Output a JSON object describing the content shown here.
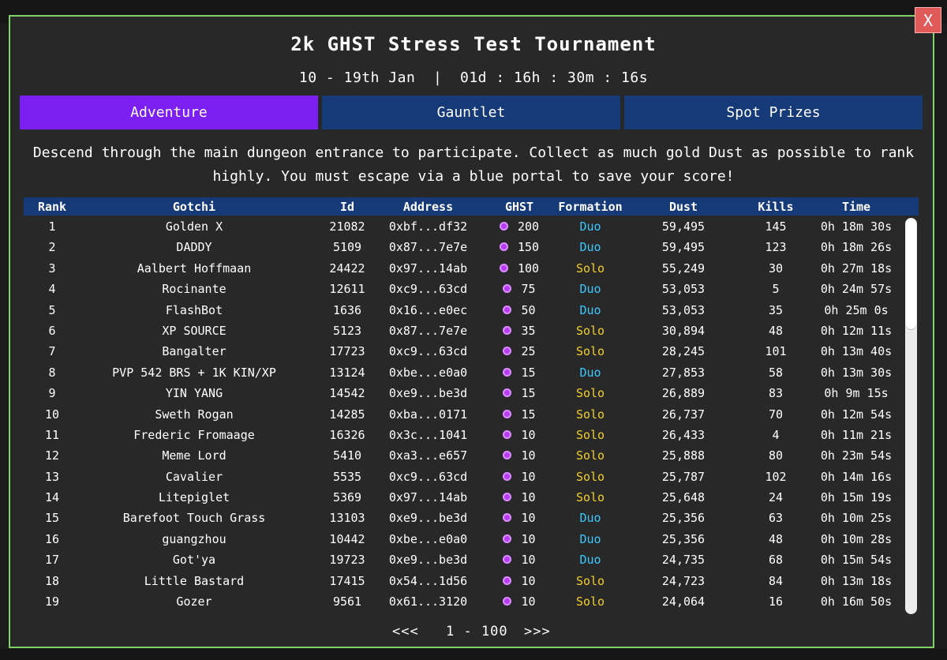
{
  "window": {
    "close_label": "X"
  },
  "header": {
    "title": "2k GHST Stress Test Tournament",
    "subtitle": "10 - 19th Jan  |  01d : 16h : 30m : 16s"
  },
  "tabs": [
    {
      "label": "Adventure",
      "active": true
    },
    {
      "label": "Gauntlet",
      "active": false
    },
    {
      "label": "Spot Prizes",
      "active": false
    }
  ],
  "description": "Descend through the main dungeon entrance to participate. Collect as much gold Dust as possible to rank highly. You must escape via a blue portal to save your score!",
  "columns": {
    "rank": "Rank",
    "gotchi": "Gotchi",
    "id": "Id",
    "address": "Address",
    "ghst": "GHST",
    "formation": "Formation",
    "dust": "Dust",
    "kills": "Kills",
    "time": "Time"
  },
  "colors": {
    "accent": "#7b1ff2",
    "tab": "#163a78",
    "duo": "#3cc8ff",
    "solo": "#f2cf2d",
    "border": "#7fd16a"
  },
  "rows": [
    {
      "rank": "1",
      "gotchi": "Golden X",
      "id": "21082",
      "address": "0xbf...df32",
      "ghst": "200",
      "formation": "Duo",
      "dust": "59,495",
      "kills": "145",
      "time": "0h 18m 30s"
    },
    {
      "rank": "2",
      "gotchi": "DADDY",
      "id": "5109",
      "address": "0x87...7e7e",
      "ghst": "150",
      "formation": "Duo",
      "dust": "59,495",
      "kills": "123",
      "time": "0h 18m 26s"
    },
    {
      "rank": "3",
      "gotchi": "Aalbert Hoffmaan",
      "id": "24422",
      "address": "0x97...14ab",
      "ghst": "100",
      "formation": "Solo",
      "dust": "55,249",
      "kills": "30",
      "time": "0h 27m 18s"
    },
    {
      "rank": "4",
      "gotchi": "Rocinante",
      "id": "12611",
      "address": "0xc9...63cd",
      "ghst": "75",
      "formation": "Duo",
      "dust": "53,053",
      "kills": "5",
      "time": "0h 24m 57s"
    },
    {
      "rank": "5",
      "gotchi": "FlashBot",
      "id": "1636",
      "address": "0x16...e0ec",
      "ghst": "50",
      "formation": "Duo",
      "dust": "53,053",
      "kills": "35",
      "time": "0h 25m 0s"
    },
    {
      "rank": "6",
      "gotchi": "XP SOURCE",
      "id": "5123",
      "address": "0x87...7e7e",
      "ghst": "35",
      "formation": "Solo",
      "dust": "30,894",
      "kills": "48",
      "time": "0h 12m 11s"
    },
    {
      "rank": "7",
      "gotchi": "Bangalter",
      "id": "17723",
      "address": "0xc9...63cd",
      "ghst": "25",
      "formation": "Solo",
      "dust": "28,245",
      "kills": "101",
      "time": "0h 13m 40s"
    },
    {
      "rank": "8",
      "gotchi": "PVP 542 BRS + 1K KIN/XP",
      "id": "13124",
      "address": "0xbe...e0a0",
      "ghst": "15",
      "formation": "Duo",
      "dust": "27,853",
      "kills": "58",
      "time": "0h 13m 30s"
    },
    {
      "rank": "9",
      "gotchi": "YIN YANG",
      "id": "14542",
      "address": "0xe9...be3d",
      "ghst": "15",
      "formation": "Solo",
      "dust": "26,889",
      "kills": "83",
      "time": "0h 9m 15s"
    },
    {
      "rank": "10",
      "gotchi": "Sweth Rogan",
      "id": "14285",
      "address": "0xba...0171",
      "ghst": "15",
      "formation": "Solo",
      "dust": "26,737",
      "kills": "70",
      "time": "0h 12m 54s"
    },
    {
      "rank": "11",
      "gotchi": "Frederic Fromaage",
      "id": "16326",
      "address": "0x3c...1041",
      "ghst": "10",
      "formation": "Solo",
      "dust": "26,433",
      "kills": "4",
      "time": "0h 11m 21s"
    },
    {
      "rank": "12",
      "gotchi": "Meme Lord",
      "id": "5410",
      "address": "0xa3...e657",
      "ghst": "10",
      "formation": "Solo",
      "dust": "25,888",
      "kills": "80",
      "time": "0h 23m 54s"
    },
    {
      "rank": "13",
      "gotchi": "Cavalier",
      "id": "5535",
      "address": "0xc9...63cd",
      "ghst": "10",
      "formation": "Solo",
      "dust": "25,787",
      "kills": "102",
      "time": "0h 14m 16s"
    },
    {
      "rank": "14",
      "gotchi": "Litepiglet",
      "id": "5369",
      "address": "0x97...14ab",
      "ghst": "10",
      "formation": "Solo",
      "dust": "25,648",
      "kills": "24",
      "time": "0h 15m 19s"
    },
    {
      "rank": "15",
      "gotchi": "Barefoot Touch Grass",
      "id": "13103",
      "address": "0xe9...be3d",
      "ghst": "10",
      "formation": "Duo",
      "dust": "25,356",
      "kills": "63",
      "time": "0h 10m 25s"
    },
    {
      "rank": "16",
      "gotchi": "guangzhou",
      "id": "10442",
      "address": "0xbe...e0a0",
      "ghst": "10",
      "formation": "Duo",
      "dust": "25,356",
      "kills": "48",
      "time": "0h 10m 28s"
    },
    {
      "rank": "17",
      "gotchi": "Got'ya",
      "id": "19723",
      "address": "0xe9...be3d",
      "ghst": "10",
      "formation": "Duo",
      "dust": "24,735",
      "kills": "68",
      "time": "0h 15m 54s"
    },
    {
      "rank": "18",
      "gotchi": "Little Bastard",
      "id": "17415",
      "address": "0x54...1d56",
      "ghst": "10",
      "formation": "Solo",
      "dust": "24,723",
      "kills": "84",
      "time": "0h 13m 18s"
    },
    {
      "rank": "19",
      "gotchi": "Gozer",
      "id": "9561",
      "address": "0x61...3120",
      "ghst": "10",
      "formation": "Solo",
      "dust": "24,064",
      "kills": "16",
      "time": "0h 16m 50s"
    }
  ],
  "pagination": {
    "prev": "<<<",
    "range": "1 - 100",
    "next": ">>>"
  }
}
